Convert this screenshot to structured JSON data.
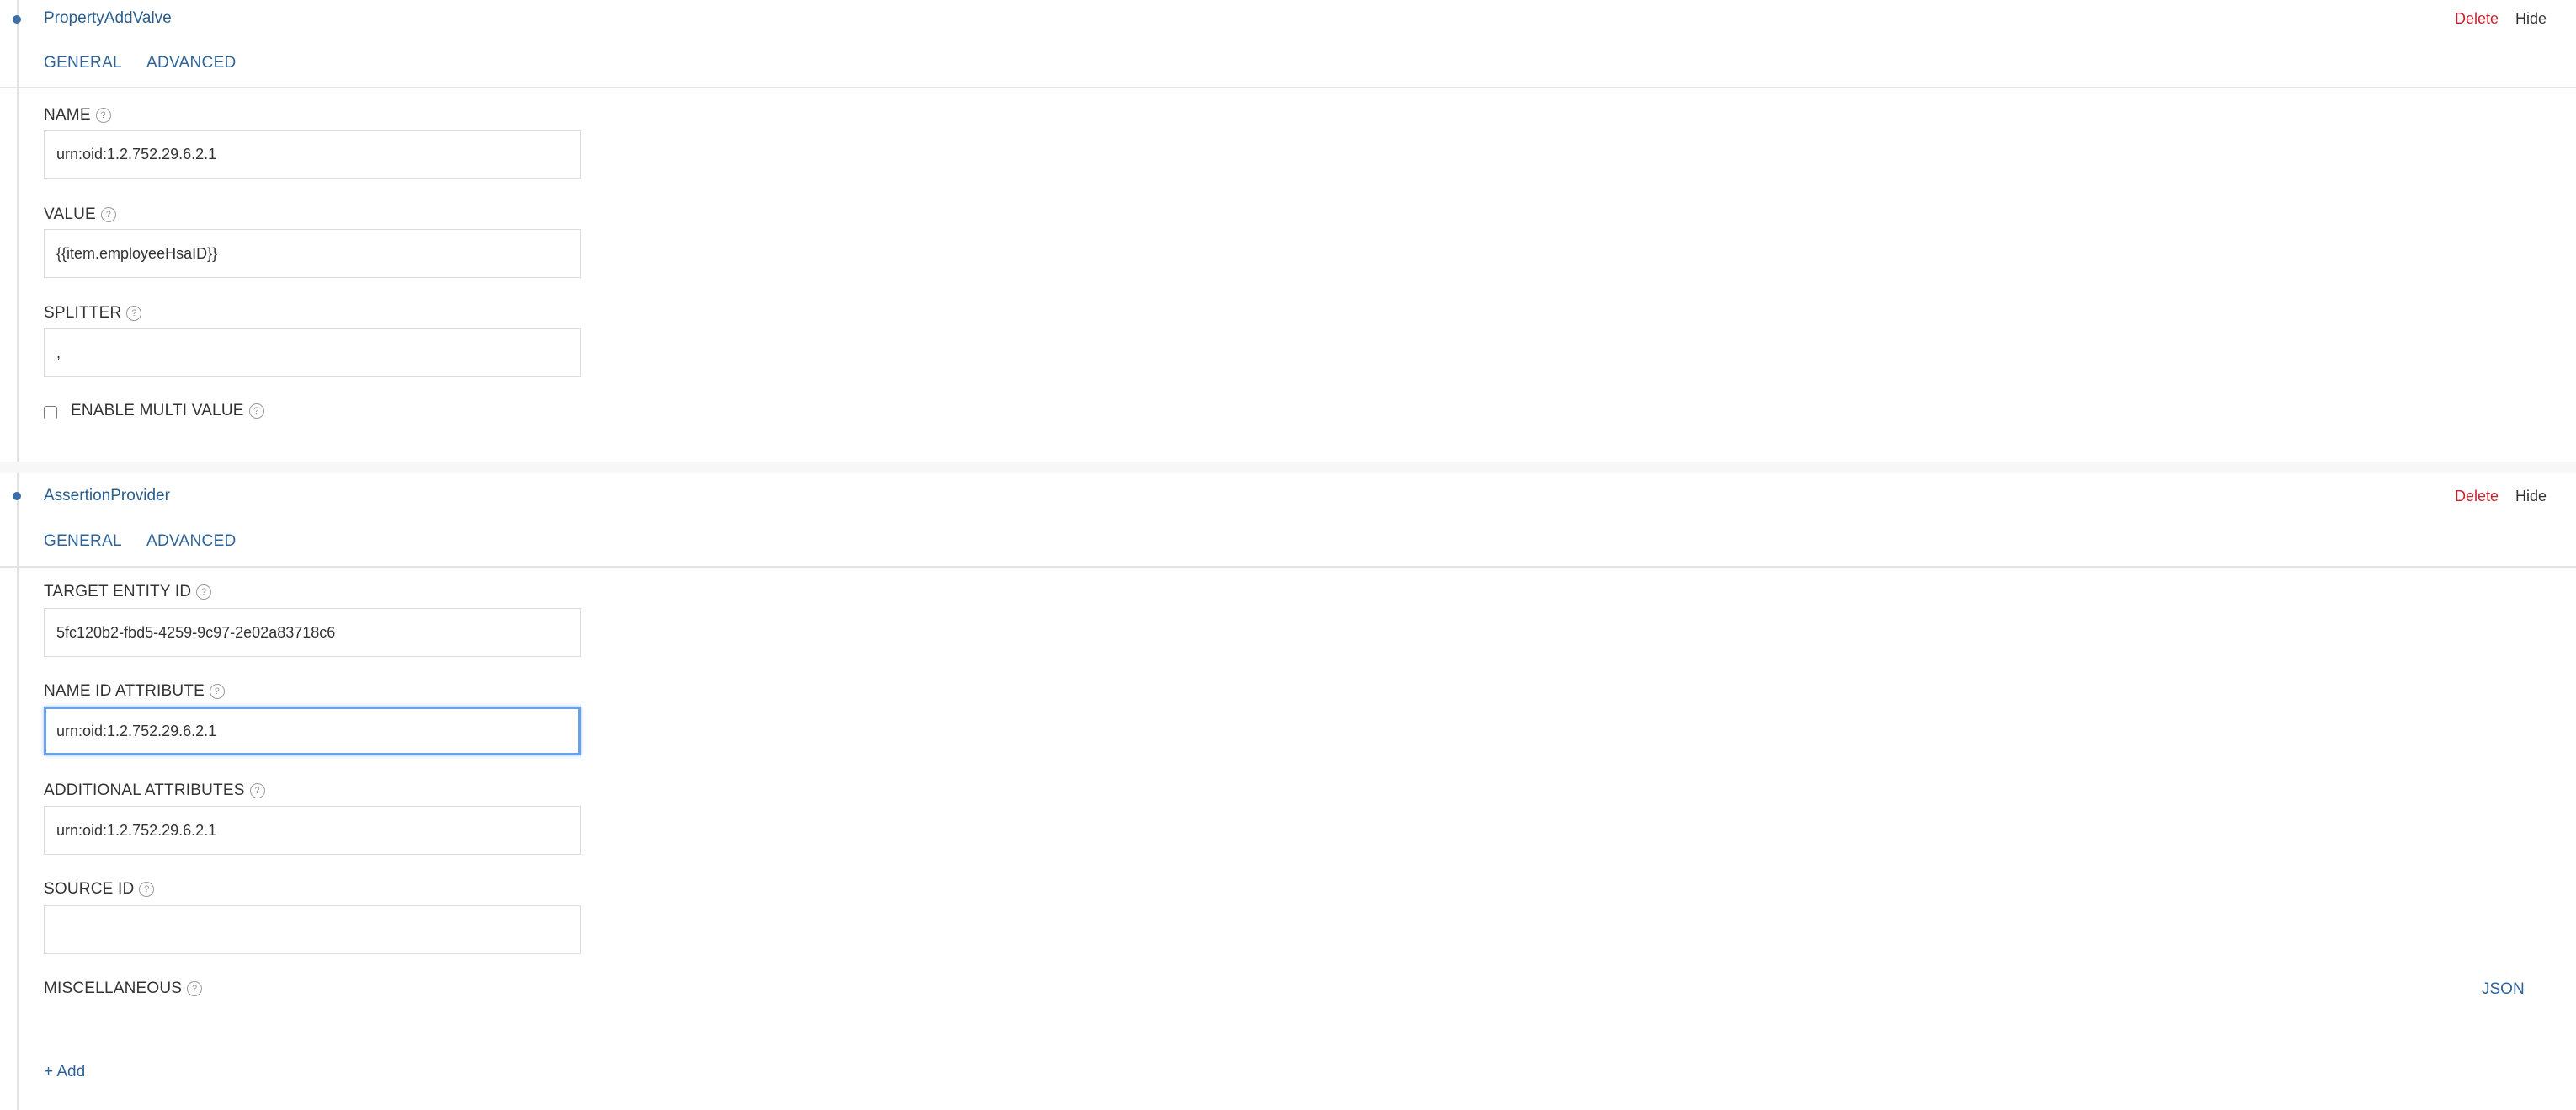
{
  "panels": [
    {
      "title": "PropertyAddValve",
      "delete_label": "Delete",
      "hide_label": "Hide",
      "tabs": [
        "GENERAL",
        "ADVANCED"
      ],
      "fields": [
        {
          "label": "NAME",
          "value": "urn:oid:1.2.752.29.6.2.1"
        },
        {
          "label": "VALUE",
          "value": "{{item.employeeHsaID}}"
        },
        {
          "label": "SPLITTER",
          "value": ","
        }
      ],
      "checkbox": {
        "label": "ENABLE MULTI VALUE",
        "checked": false
      }
    },
    {
      "title": "AssertionProvider",
      "delete_label": "Delete",
      "hide_label": "Hide",
      "tabs": [
        "GENERAL",
        "ADVANCED"
      ],
      "fields": [
        {
          "label": "TARGET ENTITY ID",
          "value": "5fc120b2-fbd5-4259-9c97-2e02a83718c6"
        },
        {
          "label": "NAME ID ATTRIBUTE",
          "value": "urn:oid:1.2.752.29.6.2.1"
        },
        {
          "label": "ADDITIONAL ATTRIBUTES",
          "value": "urn:oid:1.2.752.29.6.2.1"
        },
        {
          "label": "SOURCE ID",
          "value": ""
        }
      ],
      "misc_label": "MISCELLANEOUS",
      "json_label": "JSON"
    }
  ],
  "add_label": "+ Add",
  "help_glyph": "?",
  "colors": {
    "accent": "#2f6398",
    "delete": "#c3232f",
    "focus": "#6aa0e8"
  }
}
